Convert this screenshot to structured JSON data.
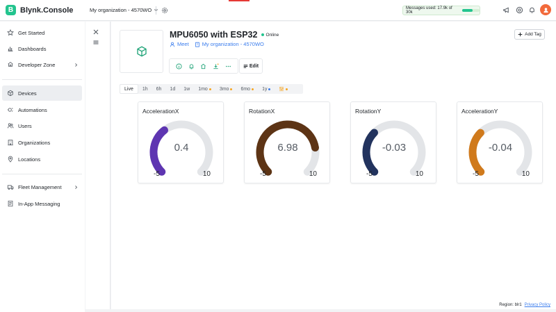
{
  "app": {
    "logo_letter": "B",
    "name": "Blynk.Console"
  },
  "topbar": {
    "org_name": "My organization - 4570WO",
    "messages_label": "Messages used: 17.9k of 30k",
    "messages_used_fraction": 0.6,
    "accent": "#23c48e"
  },
  "sidebar": {
    "items": [
      {
        "label": "Get Started",
        "icon": "star-icon"
      },
      {
        "label": "Dashboards",
        "icon": "bar-chart-icon"
      },
      {
        "label": "Developer Zone",
        "icon": "developer-icon"
      },
      {
        "label": "Devices",
        "icon": "cube-icon"
      },
      {
        "label": "Automations",
        "icon": "automation-icon"
      },
      {
        "label": "Users",
        "icon": "users-icon"
      },
      {
        "label": "Organizations",
        "icon": "building-icon"
      },
      {
        "label": "Locations",
        "icon": "location-pin-icon"
      },
      {
        "label": "Fleet Management",
        "icon": "truck-icon"
      },
      {
        "label": "In-App Messaging",
        "icon": "message-icon"
      }
    ]
  },
  "device": {
    "title": "MPU6050 with ESP32",
    "status": "Online",
    "owner": "Meet",
    "organization": "My organization - 4570WO",
    "edit_label": "Edit",
    "add_tag_label": "Add Tag"
  },
  "time_ranges": [
    "Live",
    "1h",
    "6h",
    "1d",
    "1w",
    "1mo",
    "3mo",
    "6mo",
    "1y"
  ],
  "gauges": [
    {
      "title": "AccelerationX",
      "value": "0.4",
      "min": "-5",
      "max": "10",
      "color": "#5e35b1"
    },
    {
      "title": "RotationX",
      "value": "6.98",
      "min": "-5",
      "max": "10",
      "color": "#5d3415"
    },
    {
      "title": "RotationY",
      "value": "-0.03",
      "min": "-5",
      "max": "10",
      "color": "#22335e"
    },
    {
      "title": "AccelerationY",
      "value": "-0.04",
      "min": "-5",
      "max": "10",
      "color": "#d07a1c"
    }
  ],
  "footer": {
    "region": "Region: blr1",
    "privacy": "Privacy Policy"
  }
}
